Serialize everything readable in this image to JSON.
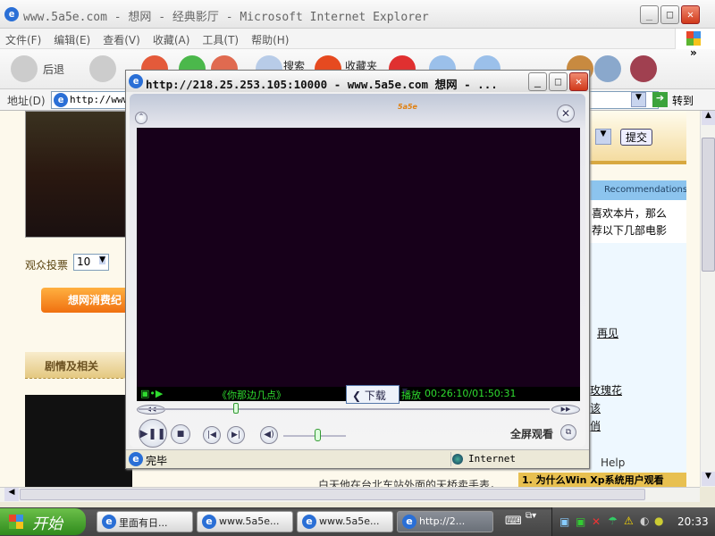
{
  "main_window": {
    "title": "www.5a5e.com - 想网 - 经典影厅 - Microsoft Internet Explorer"
  },
  "menu": [
    "文件(F)",
    "编辑(E)",
    "查看(V)",
    "收藏(A)",
    "工具(T)",
    "帮助(H)"
  ],
  "toolbar": {
    "back": "后退",
    "search": "搜索",
    "favorites": "收藏夹",
    "more": "»"
  },
  "address": {
    "label": "地址(D)",
    "value": "http://www",
    "go": "转到"
  },
  "page": {
    "vote_label": "观众投票",
    "vote_value": "10",
    "submit": "提交",
    "consume_button": "想网消费纪",
    "section_title": "剧情及相关",
    "recommend_header": "Recommendations",
    "recommend_text": [
      "喜欢本片，那么",
      "荐以下几部电影"
    ],
    "links": [
      "再见",
      "玫瑰花",
      "该",
      "俏"
    ],
    "help": "Help",
    "story_text": "白天他在台北车站外面的天桥卖手表，",
    "faq_item": "1. 为什么Win Xp系统用户观看"
  },
  "popup": {
    "title": "http://218.25.253.105:10000 - www.5a5e.com 想网 - ...",
    "logo": "5a5e.com 想网",
    "movie_title": "《你那边几点》",
    "download": "下载",
    "play_status": "播放",
    "time": "00:26:10/01:50:31",
    "progress": 0.236,
    "volume": 0.5,
    "fullscreen": "全屏观看",
    "status_text": "完毕",
    "zone": "Internet"
  },
  "taskbar": {
    "start": "开始",
    "tasks": [
      "里面有日...",
      "www.5a5e...",
      "www.5a5e...",
      "http://2..."
    ],
    "clock": "20:33"
  }
}
